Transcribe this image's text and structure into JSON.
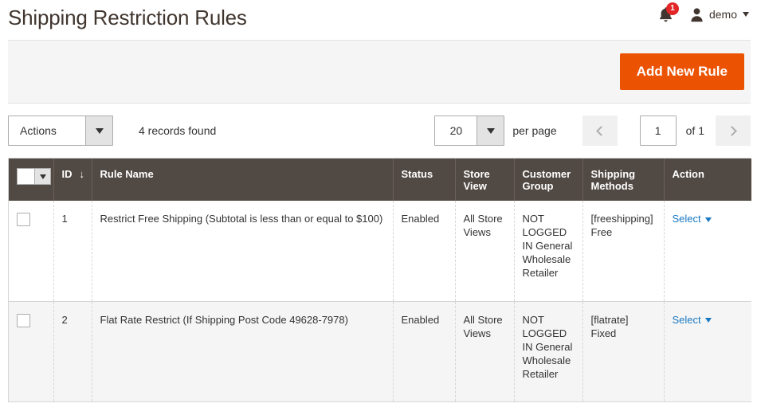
{
  "header": {
    "title": "Shipping Restriction Rules",
    "notification_count": "1",
    "user_name": "demo",
    "bell_icon": "bell-icon",
    "avatar_icon": "user-avatar-icon",
    "caret_icon": "chevron-down-icon"
  },
  "page_actions": {
    "add_new_rule_label": "Add New Rule",
    "primary_color": "#eb5202"
  },
  "toolbar": {
    "actions_label": "Actions",
    "records_found": "4 records found",
    "per_page_value": "20",
    "per_page_label": "per page",
    "page_value": "1",
    "of_total": "of 1",
    "prev_icon": "chevron-left-icon",
    "next_icon": "chevron-right-icon"
  },
  "grid": {
    "columns": [
      {
        "key": "checkbox",
        "label": ""
      },
      {
        "key": "id",
        "label": "ID",
        "sort": "↓"
      },
      {
        "key": "name",
        "label": "Rule Name"
      },
      {
        "key": "status",
        "label": "Status"
      },
      {
        "key": "store_view",
        "label": "Store View"
      },
      {
        "key": "customer_group",
        "label": "Customer Group"
      },
      {
        "key": "shipping_methods",
        "label": "Shipping Methods"
      },
      {
        "key": "action",
        "label": "Action"
      }
    ],
    "rows": [
      {
        "id": "1",
        "name": "Restrict Free Shipping (Subtotal is less than or equal to $100)",
        "status": "Enabled",
        "store_view": "All Store Views",
        "customer_group": "NOT LOGGED IN General Wholesale Retailer",
        "shipping_methods": "[freeshipping] Free",
        "action": "Select"
      },
      {
        "id": "2",
        "name": "Flat Rate Restrict (If Shipping Post Code 49628-7978)",
        "status": "Enabled",
        "store_view": "All Store Views",
        "customer_group": "NOT LOGGED IN General Wholesale Retailer",
        "shipping_methods": "[flatrate] Fixed",
        "action": "Select"
      }
    ],
    "header_bg": "#514943",
    "link_color": "#1979c3"
  }
}
